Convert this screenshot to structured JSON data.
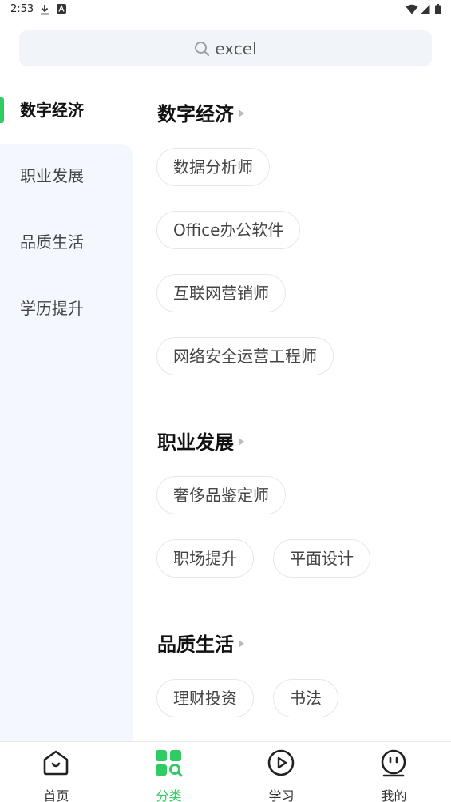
{
  "status_bar": {
    "time": "2:53"
  },
  "search": {
    "query": "excel"
  },
  "sidebar": {
    "items": [
      {
        "label": "数字经济",
        "active": true
      },
      {
        "label": "职业发展",
        "active": false
      },
      {
        "label": "品质生活",
        "active": false
      },
      {
        "label": "学历提升",
        "active": false
      }
    ]
  },
  "sections": [
    {
      "title": "数字经济",
      "chips": [
        "数据分析师",
        "Office办公软件",
        "互联网营销师",
        "网络安全运营工程师"
      ]
    },
    {
      "title": "职业发展",
      "chips": [
        "奢侈品鉴定师",
        "职场提升",
        "平面设计"
      ]
    },
    {
      "title": "品质生活",
      "chips": [
        "理财投资",
        "书法"
      ]
    }
  ],
  "bottom_nav": {
    "items": [
      {
        "label": "首页",
        "icon": "home-icon"
      },
      {
        "label": "分类",
        "icon": "category-icon",
        "active": true
      },
      {
        "label": "学习",
        "icon": "play-icon"
      },
      {
        "label": "我的",
        "icon": "profile-icon"
      }
    ]
  },
  "colors": {
    "accent": "#2ecc63",
    "sidebar_bg": "#f4f8fe",
    "search_bg": "#f1f4f9"
  }
}
